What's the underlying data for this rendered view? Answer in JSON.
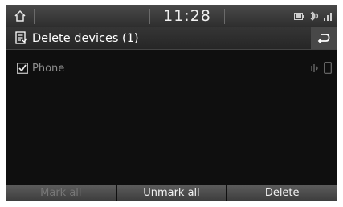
{
  "status_bar": {
    "time": "11:28",
    "icons": [
      "home-icon",
      "battery-icon",
      "bluetooth-phone-icon",
      "signal-icon"
    ]
  },
  "header": {
    "title": "Delete devices (1)",
    "icon": "list-delete-icon",
    "back_icon": "back-icon"
  },
  "device_list": [
    {
      "label": "Phone",
      "checked": true,
      "icons": [
        "audio-streaming-icon",
        "phone-icon"
      ]
    }
  ],
  "bottom_bar": {
    "mark_all": "Mark all",
    "unmark_all": "Unmark all",
    "delete": "Delete"
  },
  "colors": {
    "background": "#0f0f0f",
    "text": "#ffffff",
    "disabled_text": "#777777"
  }
}
